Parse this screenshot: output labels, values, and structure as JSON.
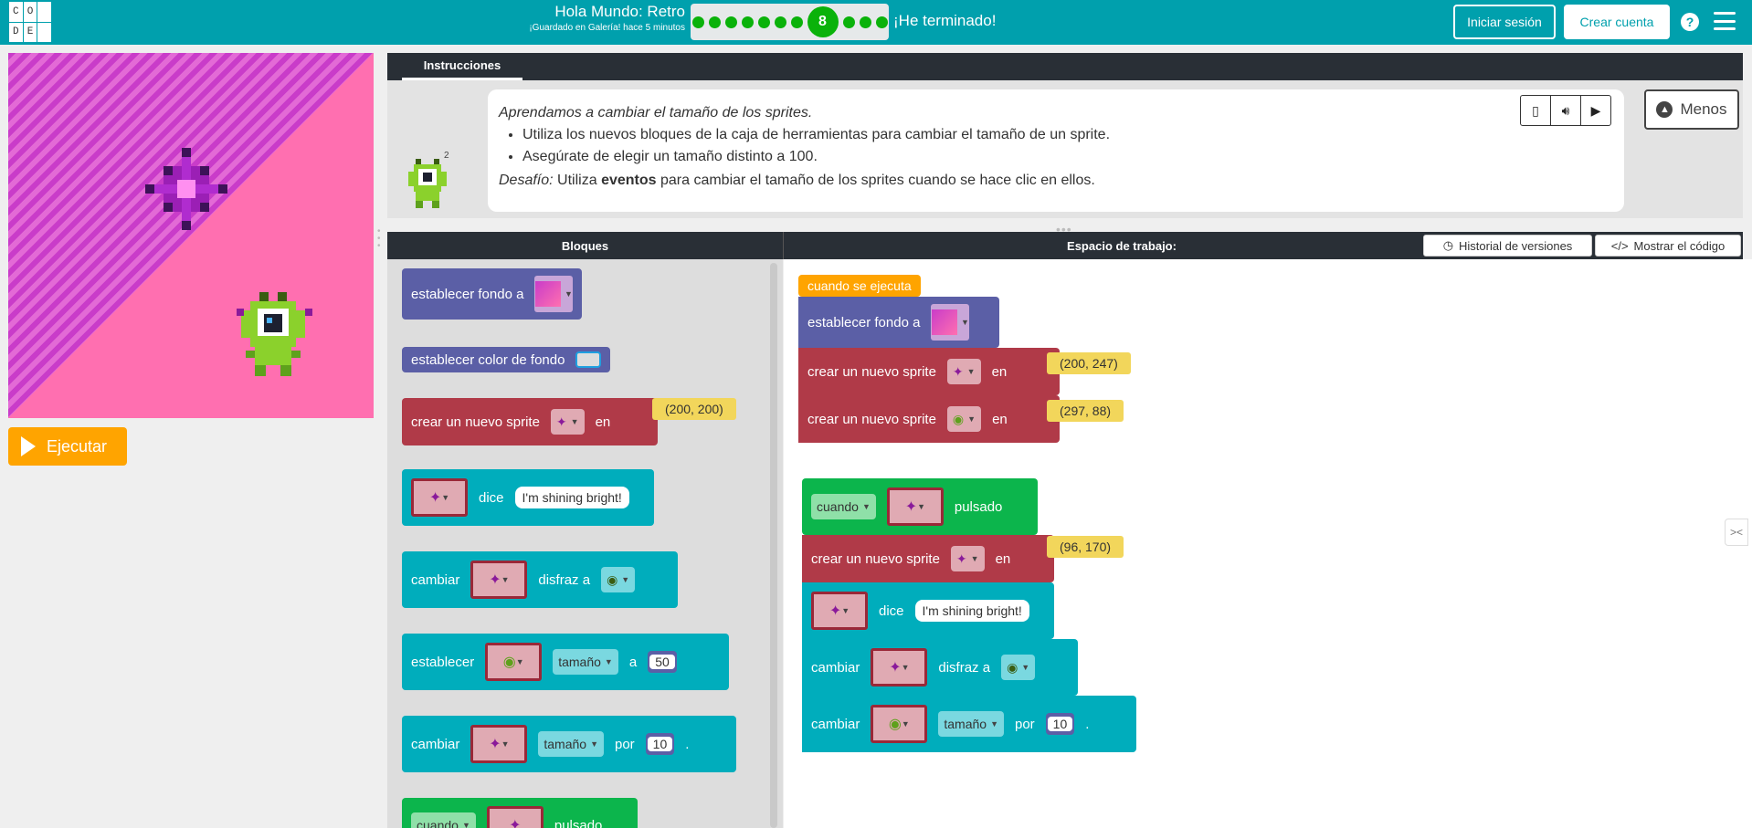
{
  "header": {
    "logo_letters": [
      "C",
      "O",
      "",
      "D",
      "E",
      ""
    ],
    "title": "Hola Mundo: Retro",
    "saved": "¡Guardado en Galería! hace 5 minutos",
    "level_current": "8",
    "finish": "¡He terminado!",
    "login": "Iniciar sesión",
    "create": "Crear cuenta",
    "help": "?"
  },
  "stage": {
    "run": "Ejecutar"
  },
  "instructions": {
    "tab": "Instrucciones",
    "line1": "Aprendamos a cambiar el tamaño de los sprites.",
    "bullets": [
      "Utiliza los nuevos bloques de la caja de herramientas para cambiar el tamaño de un sprite.",
      "Asegúrate de elegir un tamaño distinto a 100."
    ],
    "challenge_label": "Desafío:",
    "challenge_pre": "Utiliza",
    "challenge_bold": "eventos",
    "challenge_post": "para cambiar el tamaño de los sprites cuando se hace clic en ellos.",
    "badge": "2",
    "less": "Menos"
  },
  "workspace": {
    "toolbox_title": "Bloques",
    "title": "Espacio de trabajo:",
    "history": "Historial de versiones",
    "show_code": "Mostrar el código"
  },
  "toolbox": {
    "b1": "establecer fondo a",
    "b2": "establecer color de fondo",
    "b3": "crear un nuevo sprite",
    "b3_en": "en",
    "b3_loc": "(200, 200)",
    "b4_says": "dice",
    "b4_text": "I'm shining bright!",
    "b5": "cambiar",
    "b5_costume": "disfraz a",
    "b6": "establecer",
    "b6_prop": "tamaño",
    "b6_a": "a",
    "b6_val": "50",
    "b7": "cambiar",
    "b7_prop": "tamaño",
    "b7_por": "por",
    "b7_val": "10",
    "b7_dot": ".",
    "b8": "cuando",
    "b8_pulsado": "pulsado"
  },
  "program": {
    "hat": "cuando se ejecuta",
    "p1": "establecer fondo a",
    "p2": "crear un nuevo sprite",
    "p2_en": "en",
    "p2_loc": "(200, 247)",
    "p3": "crear un nuevo sprite",
    "p3_en": "en",
    "p3_loc": "(297, 88)",
    "e_cuando": "cuando",
    "e_pulsado": "pulsado",
    "e1": "crear un nuevo sprite",
    "e1_en": "en",
    "e1_loc": "(96, 170)",
    "e2_says": "dice",
    "e2_text": "I'm shining bright!",
    "e3": "cambiar",
    "e3_costume": "disfraz a",
    "e4": "cambiar",
    "e4_prop": "tamaño",
    "e4_por": "por",
    "e4_val": "10",
    "e4_dot": "."
  }
}
